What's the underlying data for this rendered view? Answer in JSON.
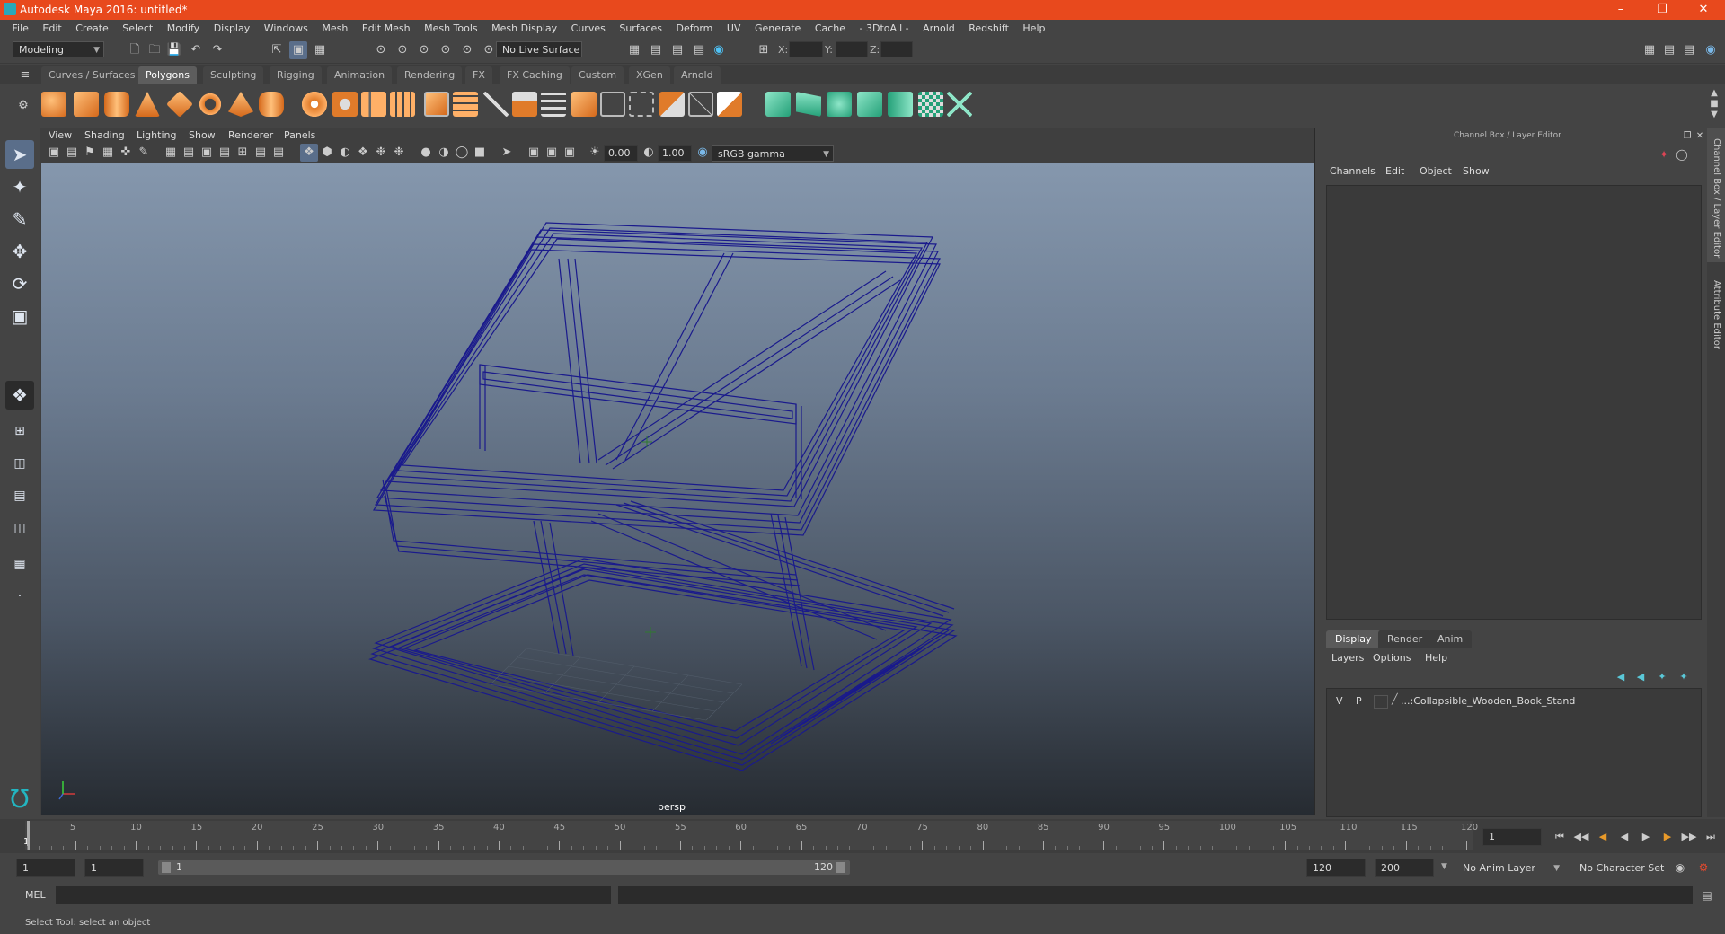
{
  "window": {
    "title": "Autodesk Maya 2016: untitled*"
  },
  "menu": [
    "File",
    "Edit",
    "Create",
    "Select",
    "Modify",
    "Display",
    "Windows",
    "Mesh",
    "Edit Mesh",
    "Mesh Tools",
    "Mesh Display",
    "Curves",
    "Surfaces",
    "Deform",
    "UV",
    "Generate",
    "Cache",
    "- 3DtoAll -",
    "Arnold",
    "Redshift",
    "Help"
  ],
  "status": {
    "mode": "Modeling",
    "live_surface": "No Live Surface",
    "x_label": "X:",
    "y_label": "Y:",
    "z_label": "Z:"
  },
  "shelf_tabs": [
    "Curves / Surfaces",
    "Polygons",
    "Sculpting",
    "Rigging",
    "Animation",
    "Rendering",
    "FX",
    "FX Caching",
    "Custom",
    "XGen",
    "Arnold"
  ],
  "shelf_active": "Polygons",
  "viewport": {
    "menu": [
      "View",
      "Shading",
      "Lighting",
      "Show",
      "Renderer",
      "Panels"
    ],
    "exposure": "0.00",
    "gamma": "1.00",
    "color_space": "sRGB gamma",
    "camera": "persp"
  },
  "channel_box": {
    "title": "Channel Box / Layer Editor",
    "menu": [
      "Channels",
      "Edit",
      "Object",
      "Show"
    ]
  },
  "layer_editor": {
    "tabs": [
      "Display",
      "Render",
      "Anim"
    ],
    "active_tab": "Display",
    "menu": [
      "Layers",
      "Options",
      "Help"
    ],
    "layers": [
      {
        "v": "V",
        "p": "P",
        "name": "...:Collapsible_Wooden_Book_Stand"
      }
    ]
  },
  "side_tabs": [
    "Channel Box / Layer Editor",
    "Attribute Editor"
  ],
  "timeline": {
    "ticks": [
      5,
      10,
      15,
      20,
      25,
      30,
      35,
      40,
      45,
      50,
      55,
      60,
      65,
      70,
      75,
      80,
      85,
      90,
      95,
      100,
      105,
      110,
      115,
      120
    ],
    "start_label": "1",
    "current_frame": "1"
  },
  "range": {
    "start": "1",
    "playback_start": "1",
    "slider_start": "1",
    "slider_end": "120",
    "playback_end": "120",
    "end": "200",
    "anim_layer": "No Anim Layer",
    "character_set": "No Character Set"
  },
  "command": {
    "label": "MEL"
  },
  "help_line": "Select Tool: select an object",
  "colors": {
    "title_bar": "#e8491d",
    "wireframe": "#1a1a8c",
    "accent": "#2aa7b8",
    "shelf_orange": "#e8892a",
    "shelf_green": "#3fb58c"
  }
}
